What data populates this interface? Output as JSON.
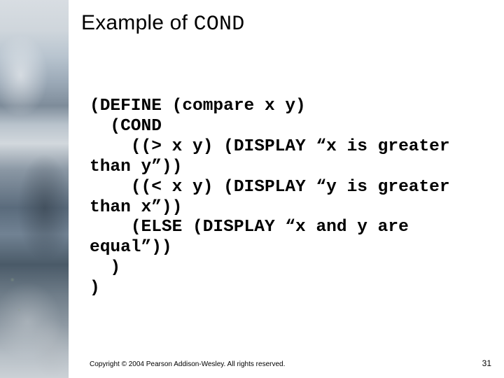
{
  "title": {
    "prefix": "Example of ",
    "mono": "COND"
  },
  "code": "(DEFINE (compare x y)\n  (COND\n    ((> x y) (DISPLAY “x is greater than y”))\n    ((< x y) (DISPLAY “y is greater than x”))\n    (ELSE (DISPLAY “x and y are equal”))\n  )\n)",
  "copyright": "Copyright © 2004 Pearson Addison-Wesley. All rights reserved.",
  "page_number": "31"
}
